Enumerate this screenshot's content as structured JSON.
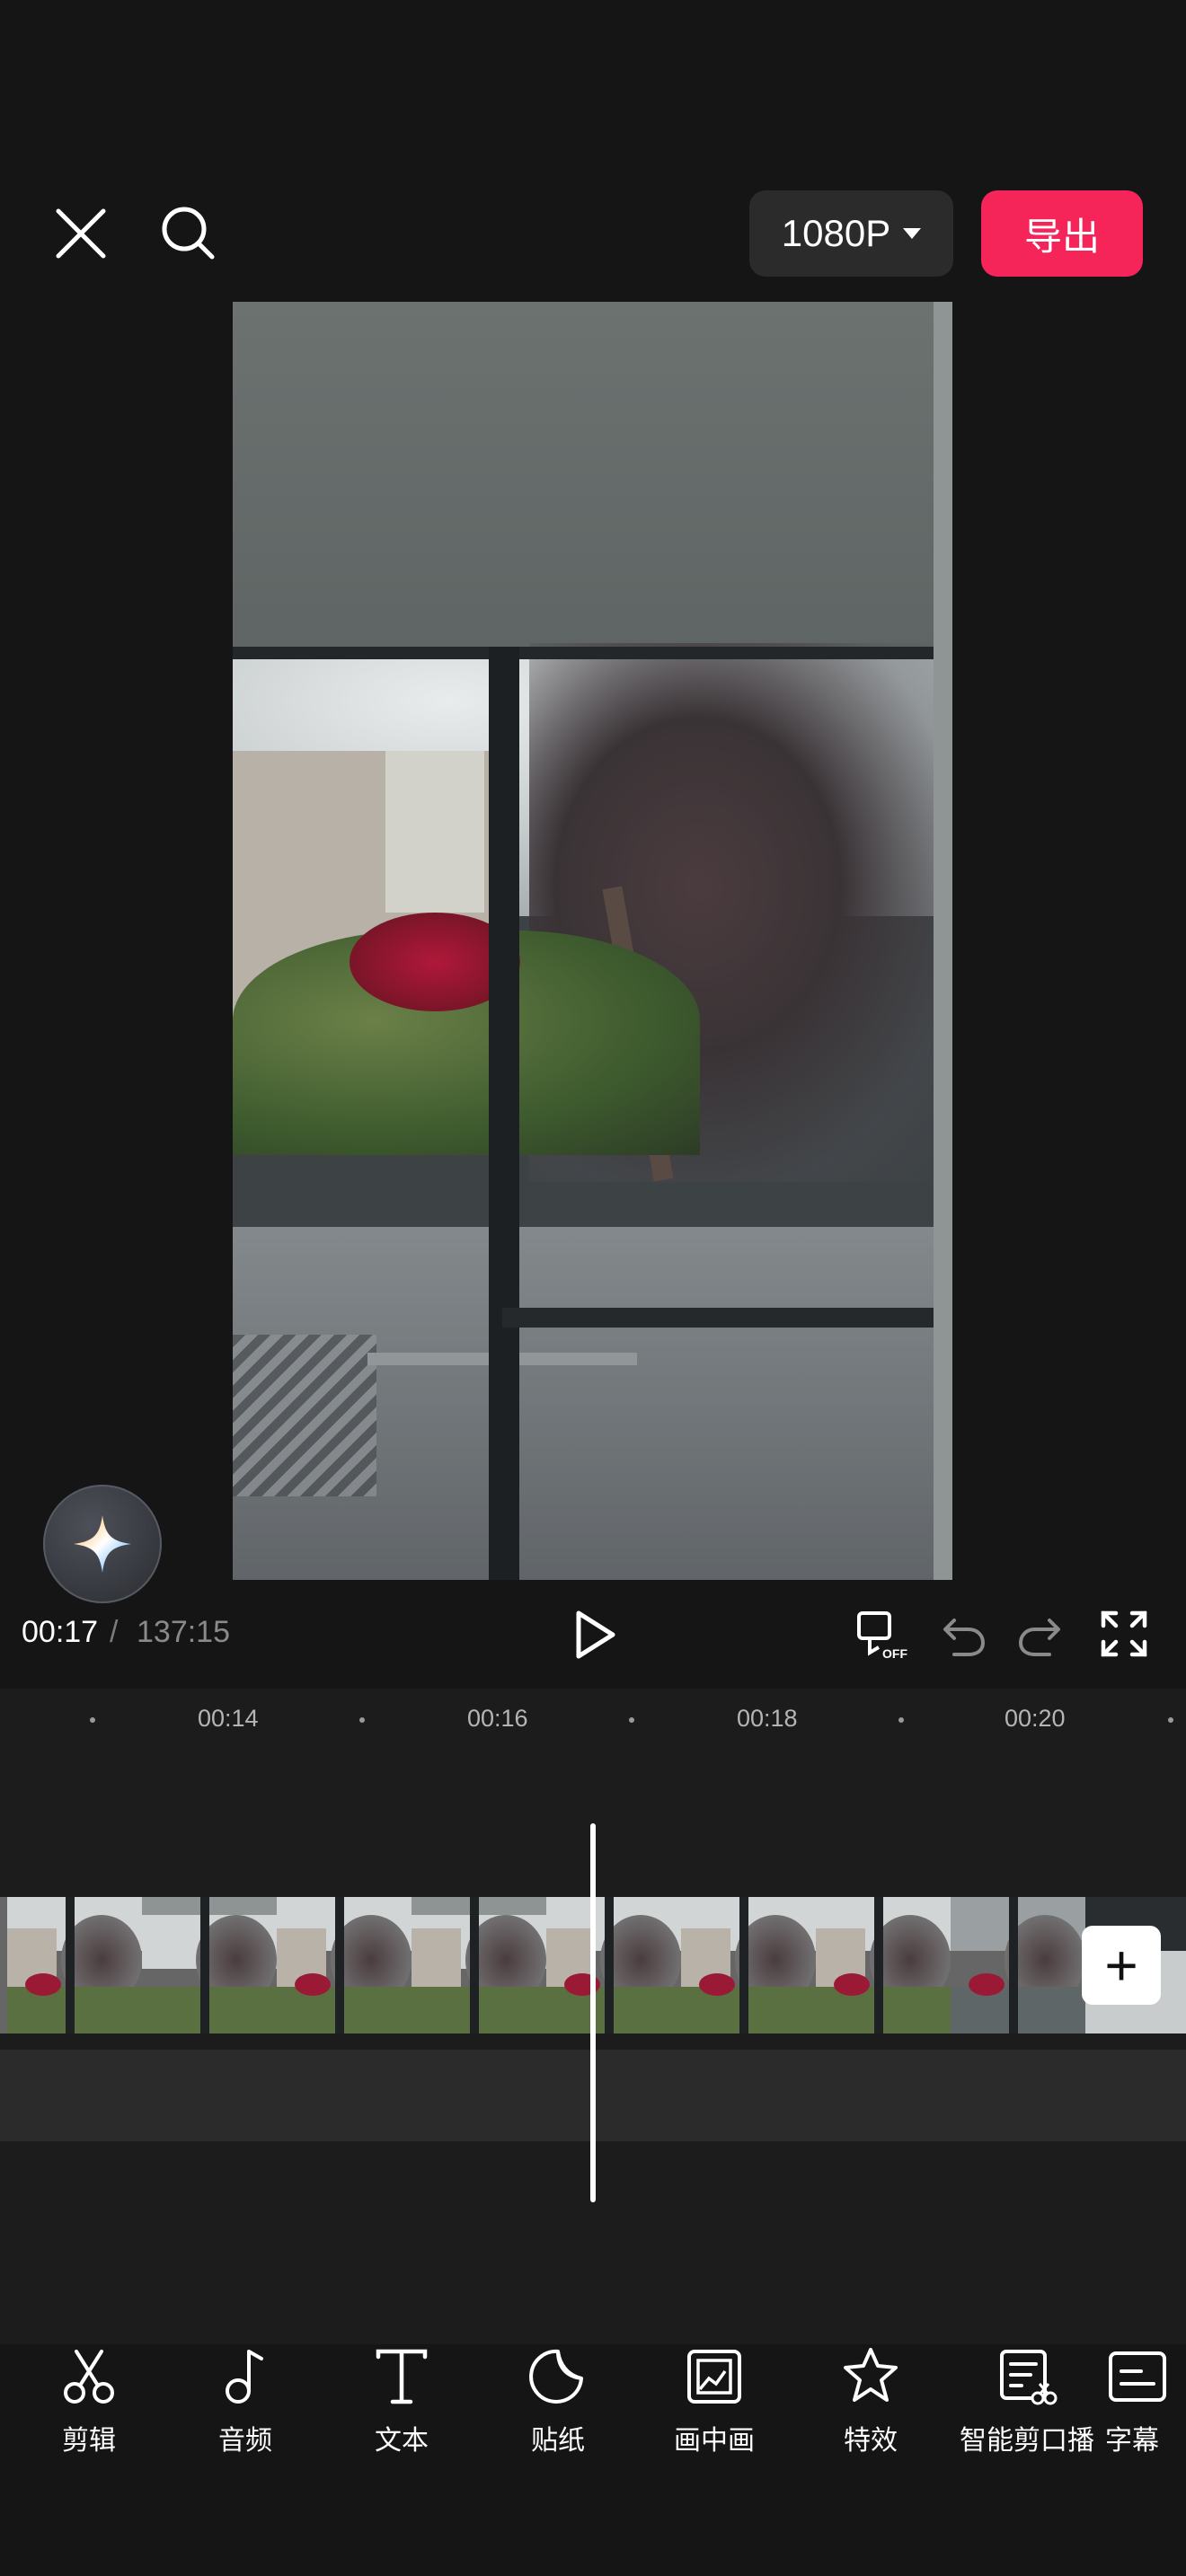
{
  "header": {
    "resolution_label": "1080P",
    "export_label": "导出"
  },
  "playback": {
    "current_time": "00:17",
    "separator": "/",
    "total_time": "137:15"
  },
  "timeline": {
    "ruler_labels": [
      "00:14",
      "00:16",
      "00:18",
      "00:20"
    ],
    "add_clip_label": "+"
  },
  "toolbar": {
    "items": [
      {
        "label": "剪辑",
        "icon": "scissors-icon"
      },
      {
        "label": "音频",
        "icon": "music-note-icon"
      },
      {
        "label": "文本",
        "icon": "text-icon"
      },
      {
        "label": "贴纸",
        "icon": "sticker-icon"
      },
      {
        "label": "画中画",
        "icon": "picture-in-picture-icon"
      },
      {
        "label": "特效",
        "icon": "effects-star-icon"
      },
      {
        "label": "智能剪口播",
        "icon": "smart-cut-icon"
      },
      {
        "label": "字幕",
        "icon": "captions-icon"
      }
    ]
  },
  "colors": {
    "background": "#151515",
    "accent": "#f5255a",
    "timeline": "#1c1c1c"
  }
}
